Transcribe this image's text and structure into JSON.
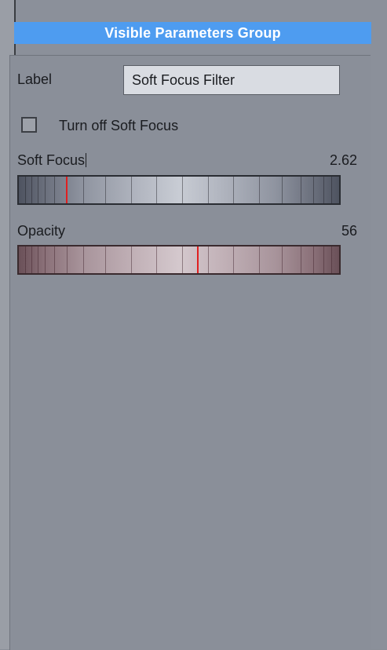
{
  "header": {
    "title": "Visible Parameters Group"
  },
  "label_field": {
    "label": "Label",
    "value": "Soft Focus Filter"
  },
  "toggle": {
    "label": "Turn off Soft Focus",
    "checked": false
  },
  "params": {
    "soft_focus": {
      "name": "Soft Focus",
      "value": "2.62",
      "level": 0.15
    },
    "opacity": {
      "name": "Opacity",
      "value": "56",
      "level": 0.56
    }
  },
  "colors": {
    "header_bg": "#4e9cf0",
    "panel_bg": "#8a8f98",
    "indicator": "#e02020"
  }
}
